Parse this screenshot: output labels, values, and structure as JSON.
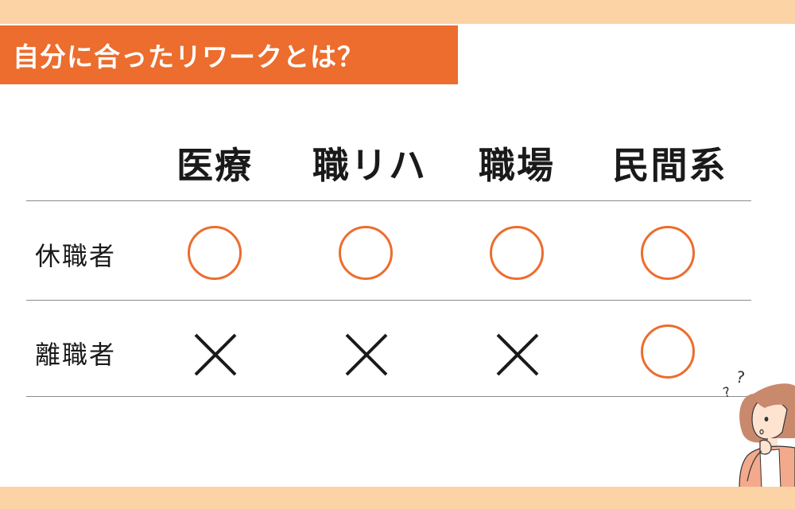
{
  "title": "自分に合ったリワークとは？",
  "columns": [
    "医療",
    "職リハ",
    "職場",
    "民間系"
  ],
  "rows": [
    {
      "label": "休職者",
      "marks": [
        "circle",
        "circle",
        "circle",
        "circle"
      ]
    },
    {
      "label": "離職者",
      "marks": [
        "cross",
        "cross",
        "cross",
        "circle"
      ]
    }
  ],
  "colors": {
    "accent": "#ec6d2d",
    "band": "#fbd3a5",
    "text": "#1a1a1a"
  },
  "illustration": "woman-thinking-with-question-marks"
}
